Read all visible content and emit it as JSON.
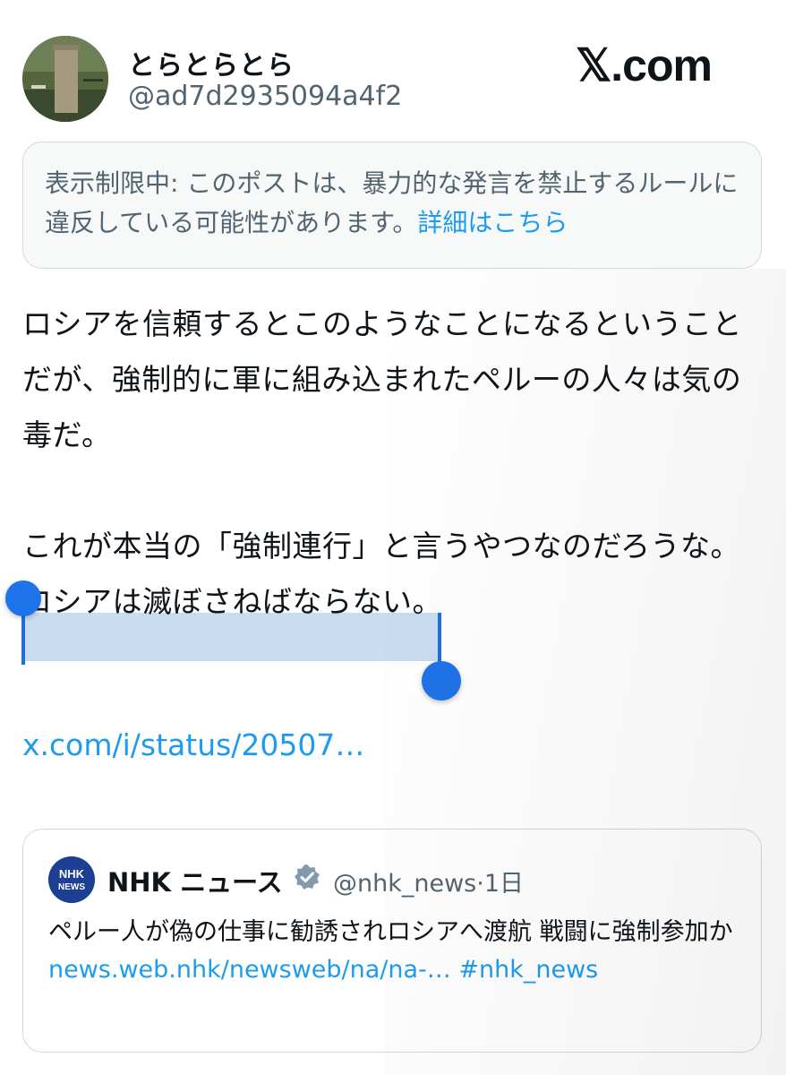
{
  "header": {
    "display_name": "とらとらとら",
    "handle": "@ad7d2935094a4f2",
    "brand": "𝕏.com"
  },
  "notice": {
    "text": "表示制限中: このポストは、暴力的な発言を禁止するルールに違反している可能性があります。",
    "link": "詳細はこちら"
  },
  "post": {
    "paragraph1": "ロシアを信頼するとこのようなことになるということだが、強制的に軍に組み込まれたペルーの人々は気の毒だ。",
    "paragraph2": "これが本当の「強制連行」と言うやつなのだろうな。",
    "selected_line": "ロシアは滅ぼさねばならない。",
    "link": "x.com/i/status/20507…"
  },
  "quote": {
    "avatar_label": "NHK\nNEWS",
    "avatar_text_top": "NHK",
    "avatar_text_bottom": "NEWS",
    "name": "NHK ニュース",
    "handle": "@nhk_news",
    "separator": "·",
    "time": "1日",
    "text": "ペルー人が偽の仕事に勧誘されロシアへ渡航 戦闘に強制参加か",
    "link": "news.web.nhk/newsweb/na/na-…",
    "hashtag": "#nhk_news"
  },
  "colors": {
    "link_blue": "#1d9bf0",
    "selection": "#c8dcf2",
    "handle_blue": "#1e73e8",
    "secondary_text": "#536471"
  }
}
